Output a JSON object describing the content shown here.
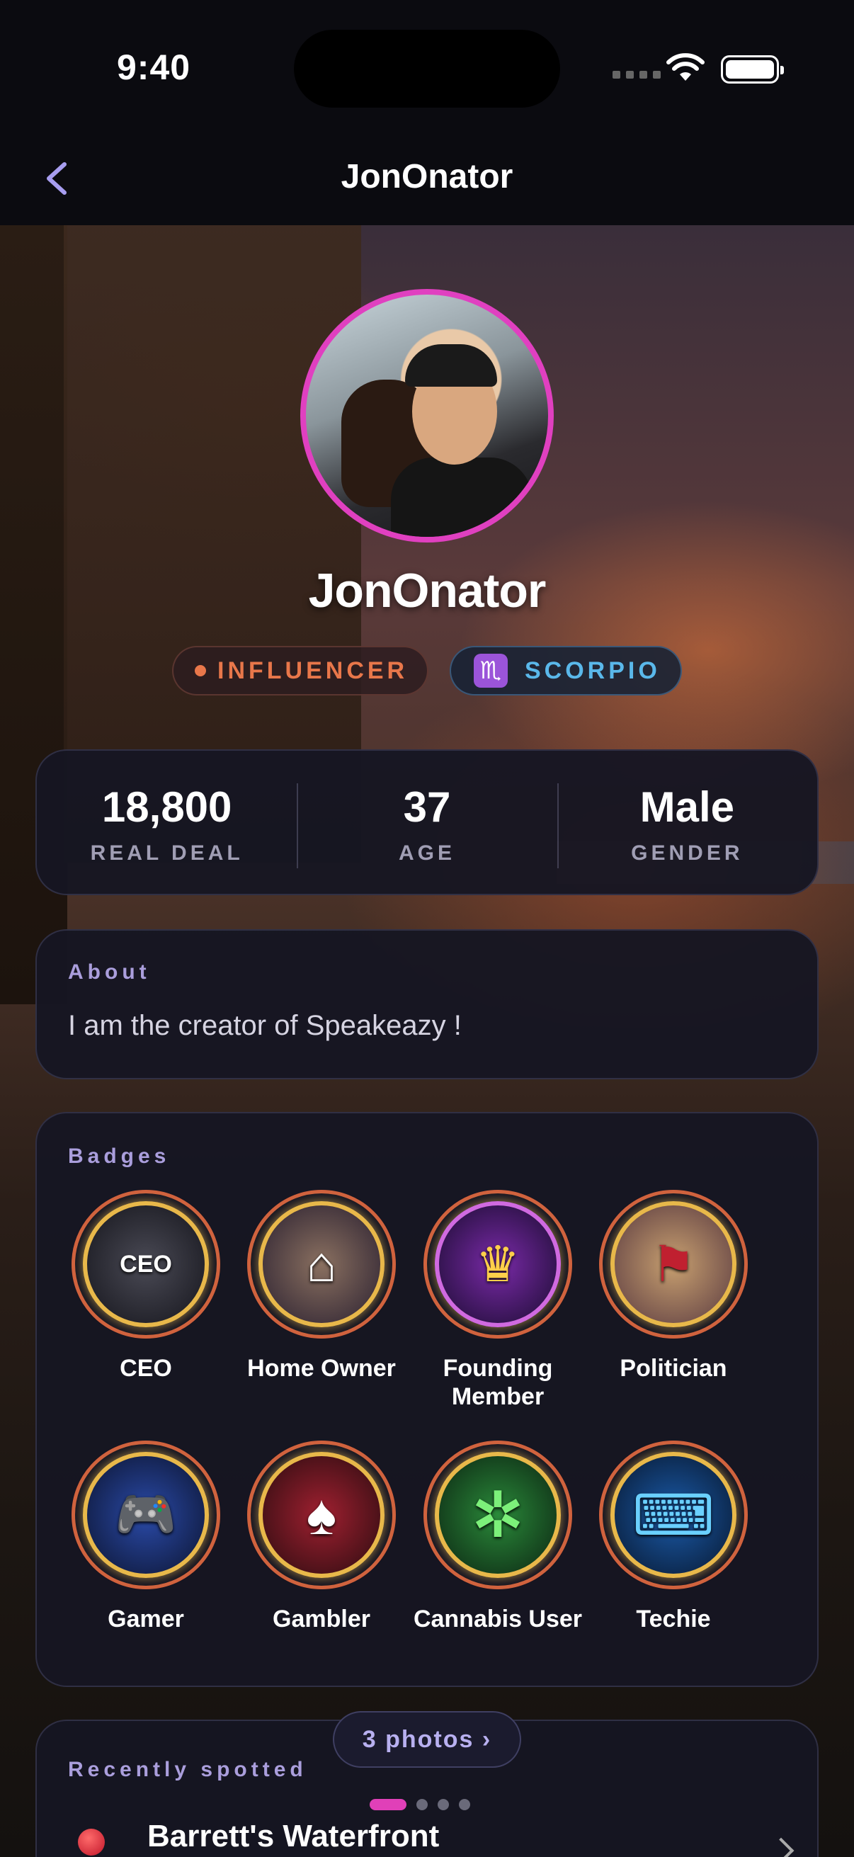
{
  "status_bar": {
    "time": "9:40"
  },
  "nav": {
    "title": "JonOnator",
    "back_icon": "chevron-left-icon"
  },
  "profile": {
    "name": "JonOnator",
    "tags": [
      {
        "label": "INFLUENCER",
        "color": "#e8774a"
      },
      {
        "label": "SCORPIO",
        "icon": "♏",
        "color": "#5ab8ea"
      }
    ],
    "avatar_ring_color": "#e040c0"
  },
  "stats": [
    {
      "value": "18,800",
      "label": "REAL DEAL"
    },
    {
      "value": "37",
      "label": "AGE"
    },
    {
      "value": "Male",
      "label": "GENDER"
    }
  ],
  "about": {
    "title": "About",
    "text": "I am the creator of Speakeazy !"
  },
  "badges": {
    "title": "Badges",
    "items": [
      {
        "label": "CEO",
        "icon": "ceo-badge-icon",
        "glyph": "CEO"
      },
      {
        "label": "Home Owner",
        "icon": "home-owner-badge-icon",
        "glyph": "⌂"
      },
      {
        "label": "Founding Member",
        "icon": "founding-member-badge-icon",
        "glyph": "♛"
      },
      {
        "label": "Politician",
        "icon": "politician-badge-icon",
        "glyph": "⚑"
      },
      {
        "label": "Gamer",
        "icon": "gamer-badge-icon",
        "glyph": "🎮"
      },
      {
        "label": "Gambler",
        "icon": "gambler-badge-icon",
        "glyph": "♠"
      },
      {
        "label": "Cannabis User",
        "icon": "cannabis-badge-icon",
        "glyph": "✲"
      },
      {
        "label": "Techie",
        "icon": "techie-badge-icon",
        "glyph": "⌨"
      }
    ]
  },
  "recently_spotted": {
    "title": "Recently spotted",
    "photos_label": "3 photos ›",
    "place": "Barrett's Waterfront",
    "carousel_pages": 4,
    "carousel_active": 1
  },
  "colors": {
    "accent": "#e040c0",
    "section_title": "#aa9edc",
    "badge_ring": "#d0623e"
  }
}
